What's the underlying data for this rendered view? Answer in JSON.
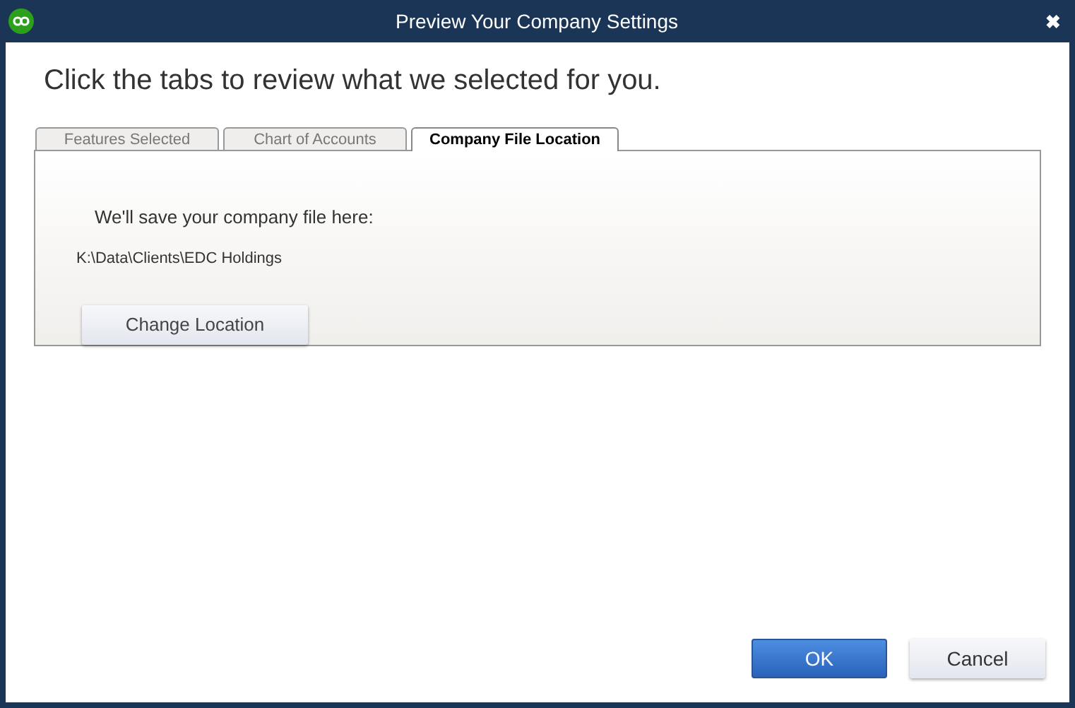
{
  "window": {
    "title": "Preview Your Company Settings",
    "close": "✖"
  },
  "heading": "Click the tabs to review what we selected for you.",
  "tabs": [
    {
      "label": "Features Selected",
      "selected": false
    },
    {
      "label": "Chart of Accounts",
      "selected": false
    },
    {
      "label": "Company File Location",
      "selected": true
    }
  ],
  "panel": {
    "intro": "We'll save your company file here:",
    "path": "K:\\Data\\Clients\\EDC Holdings",
    "button": "Change Location"
  },
  "buttons": [
    {
      "label": "OK",
      "kind": "primary"
    },
    {
      "label": "Cancel",
      "kind": "secondary"
    }
  ]
}
